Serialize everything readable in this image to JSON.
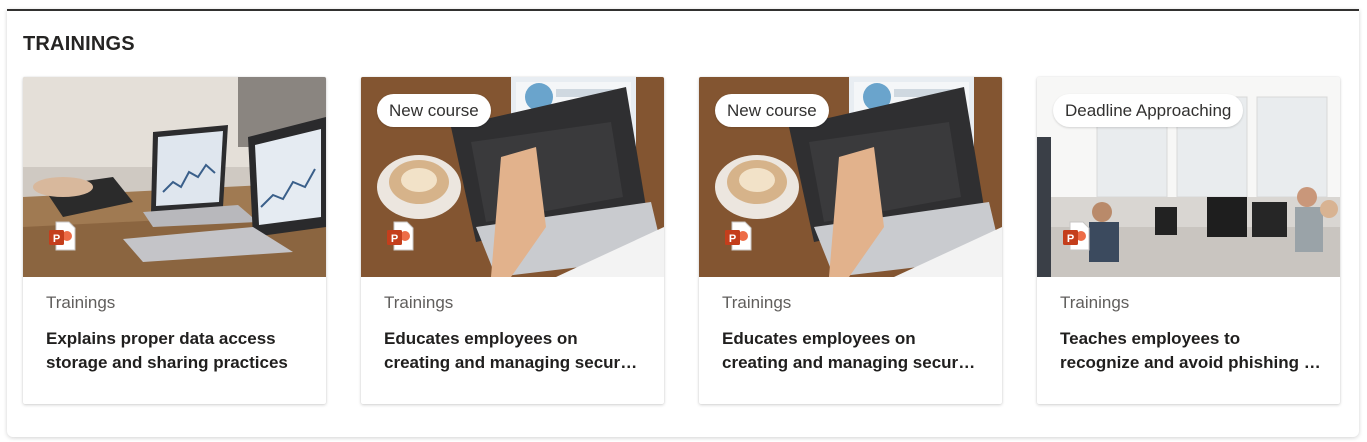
{
  "section": {
    "title": "TRAININGS"
  },
  "cards": [
    {
      "badge": "",
      "category": "Trainings",
      "line1": "Explains proper data access",
      "line2": "storage and sharing practices",
      "image": "laptops-charts-meeting"
    },
    {
      "badge": "New course",
      "category": "Trainings",
      "line1": "Educates employees on",
      "line2": "creating and managing secure passwords",
      "image": "laptop-cyber-security-coffee"
    },
    {
      "badge": "New course",
      "category": "Trainings",
      "line1": "Educates employees on",
      "line2": "creating and managing secure passwords",
      "image": "laptop-cyber-security-coffee"
    },
    {
      "badge": "Deadline Approaching",
      "category": "Trainings",
      "line1": "Teaches employees to",
      "line2": "recognize and avoid phishing attempts",
      "image": "office-team-working"
    }
  ],
  "icons": {
    "file_type": "powerpoint-icon"
  },
  "colors": {
    "ppt": "#c43e1c",
    "header_rule": "#323130"
  }
}
